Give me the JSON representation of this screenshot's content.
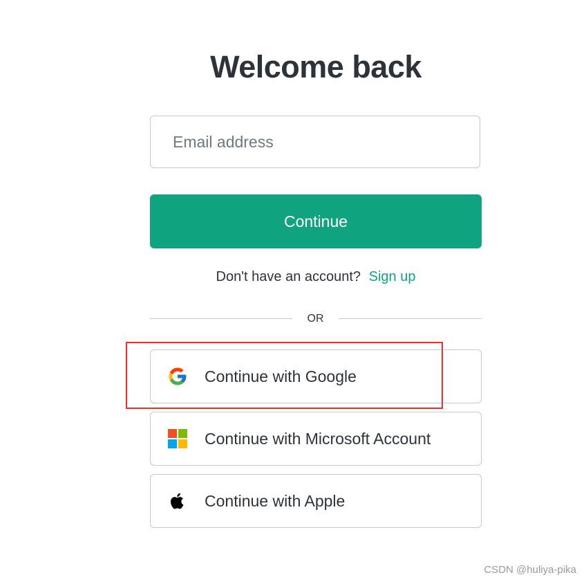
{
  "header": {
    "title": "Welcome back"
  },
  "form": {
    "email_placeholder": "Email address",
    "email_value": "",
    "continue_label": "Continue"
  },
  "signup": {
    "prompt": "Don't have an account?",
    "link_label": "Sign up"
  },
  "divider": {
    "label": "OR"
  },
  "social": {
    "google_label": "Continue with Google",
    "microsoft_label": "Continue with Microsoft Account",
    "apple_label": "Continue with Apple"
  },
  "icons": {
    "google": "google-logo-icon",
    "microsoft": "microsoft-logo-icon",
    "apple": "apple-logo-icon"
  },
  "annotation": {
    "highlight_color": "#e8312f"
  },
  "colors": {
    "accent": "#10a37f",
    "text": "#2d333a",
    "border": "#c2c8d0"
  },
  "watermark": {
    "text": "CSDN @huliya-pika"
  }
}
